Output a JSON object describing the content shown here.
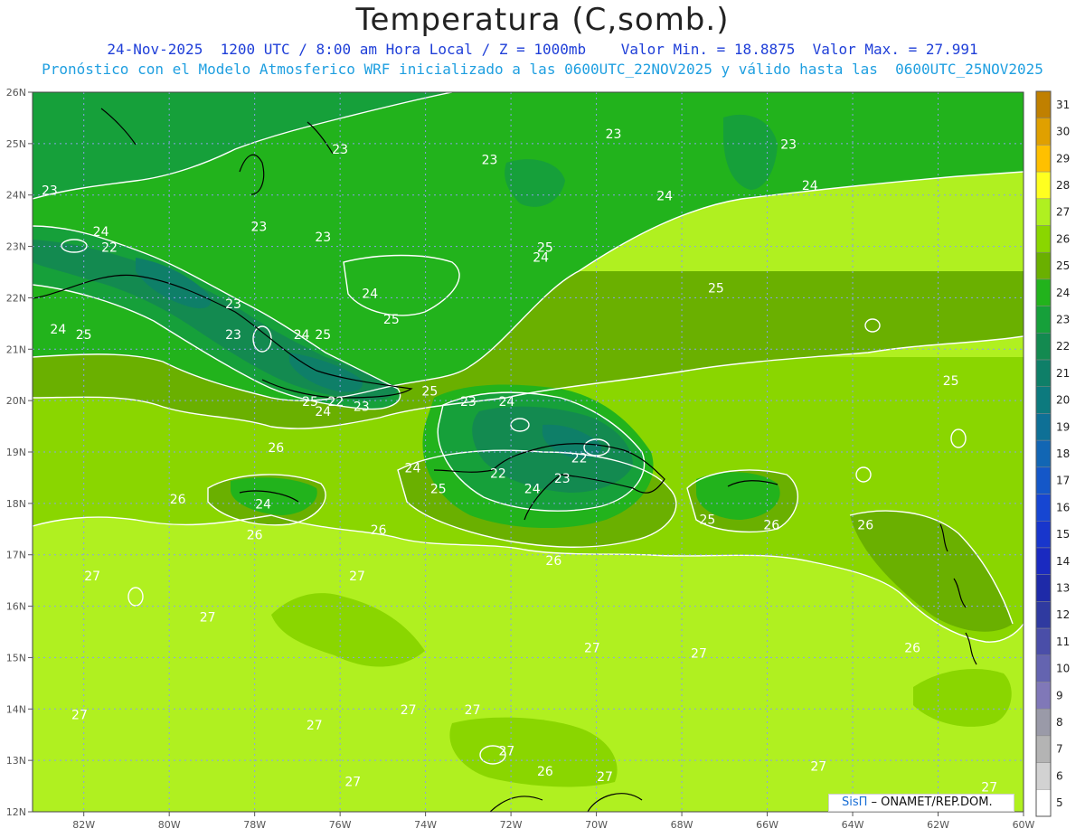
{
  "header": {
    "title": "Temperatura (C,somb.)",
    "line1": "24-Nov-2025  1200 UTC / 8:00 am Hora Local / Z = 1000mb    Valor Min. = 18.8875  Valor Max. = 27.991",
    "line2": "Pronóstico con el Modelo Atmosferico WRF inicializado a las 0600UTC_22NOV2025 y válido hasta las  0600UTC_25NOV2025"
  },
  "map": {
    "lat_ticks": [
      "26N",
      "25N",
      "24N",
      "23N",
      "22N",
      "21N",
      "20N",
      "19N",
      "18N",
      "17N",
      "16N",
      "15N",
      "14N",
      "13N",
      "12N"
    ],
    "lon_ticks": [
      "82W",
      "80W",
      "78W",
      "76W",
      "74W",
      "72W",
      "70W",
      "68W",
      "66W",
      "64W",
      "62W",
      "60W"
    ],
    "lat_range": [
      12,
      26
    ],
    "lon_range": [
      -83.2,
      -60
    ],
    "bands": [
      {
        "level": 27,
        "color": "#b0f020"
      },
      {
        "level": 26,
        "color": "#8ad600"
      },
      {
        "level": 25,
        "color": "#6ab000"
      },
      {
        "level": 24,
        "color": "#22b31c"
      },
      {
        "level": 23,
        "color": "#16a03a"
      },
      {
        "level": 22,
        "color": "#138a50"
      },
      {
        "level": 21,
        "color": "#0e7f68"
      }
    ],
    "contour_labels": [
      {
        "text": "23",
        "lon": -82.8,
        "lat": 24.0
      },
      {
        "text": "24",
        "lon": -81.6,
        "lat": 23.2
      },
      {
        "text": "22",
        "lon": -81.4,
        "lat": 22.9
      },
      {
        "text": "23",
        "lon": -76.0,
        "lat": 24.8
      },
      {
        "text": "23",
        "lon": -72.5,
        "lat": 24.6
      },
      {
        "text": "23",
        "lon": -69.6,
        "lat": 25.1
      },
      {
        "text": "23",
        "lon": -65.5,
        "lat": 24.9
      },
      {
        "text": "24",
        "lon": -65.0,
        "lat": 24.1
      },
      {
        "text": "23",
        "lon": -77.9,
        "lat": 23.3
      },
      {
        "text": "23",
        "lon": -76.4,
        "lat": 23.1
      },
      {
        "text": "24",
        "lon": -68.4,
        "lat": 23.9
      },
      {
        "text": "25",
        "lon": -71.2,
        "lat": 22.9
      },
      {
        "text": "24",
        "lon": -71.3,
        "lat": 22.7
      },
      {
        "text": "25",
        "lon": -67.2,
        "lat": 22.1
      },
      {
        "text": "24",
        "lon": -75.3,
        "lat": 22.0
      },
      {
        "text": "23",
        "lon": -78.5,
        "lat": 21.8
      },
      {
        "text": "24",
        "lon": -82.6,
        "lat": 21.3
      },
      {
        "text": "25",
        "lon": -82.0,
        "lat": 21.2
      },
      {
        "text": "23",
        "lon": -78.5,
        "lat": 21.2
      },
      {
        "text": "24",
        "lon": -76.9,
        "lat": 21.2
      },
      {
        "text": "25",
        "lon": -76.4,
        "lat": 21.2
      },
      {
        "text": "25",
        "lon": -74.8,
        "lat": 21.5
      },
      {
        "text": "25",
        "lon": -61.7,
        "lat": 20.3
      },
      {
        "text": "25",
        "lon": -73.9,
        "lat": 20.1
      },
      {
        "text": "23",
        "lon": -73.0,
        "lat": 19.9
      },
      {
        "text": "24",
        "lon": -72.1,
        "lat": 19.9
      },
      {
        "text": "25",
        "lon": -76.7,
        "lat": 19.9
      },
      {
        "text": "22",
        "lon": -76.1,
        "lat": 19.9
      },
      {
        "text": "24",
        "lon": -76.4,
        "lat": 19.7
      },
      {
        "text": "23",
        "lon": -75.5,
        "lat": 19.8
      },
      {
        "text": "26",
        "lon": -77.5,
        "lat": 19.0
      },
      {
        "text": "22",
        "lon": -70.4,
        "lat": 18.8
      },
      {
        "text": "24",
        "lon": -74.3,
        "lat": 18.6
      },
      {
        "text": "22",
        "lon": -72.3,
        "lat": 18.5
      },
      {
        "text": "23",
        "lon": -70.8,
        "lat": 18.4
      },
      {
        "text": "25",
        "lon": -73.7,
        "lat": 18.2
      },
      {
        "text": "24",
        "lon": -71.5,
        "lat": 18.2
      },
      {
        "text": "26",
        "lon": -79.8,
        "lat": 18.0
      },
      {
        "text": "24",
        "lon": -77.8,
        "lat": 17.9
      },
      {
        "text": "25",
        "lon": -67.4,
        "lat": 17.6
      },
      {
        "text": "26",
        "lon": -65.9,
        "lat": 17.5
      },
      {
        "text": "26",
        "lon": -63.7,
        "lat": 17.5
      },
      {
        "text": "26",
        "lon": -78.0,
        "lat": 17.3
      },
      {
        "text": "26",
        "lon": -75.1,
        "lat": 17.4
      },
      {
        "text": "26",
        "lon": -71.0,
        "lat": 16.8
      },
      {
        "text": "27",
        "lon": -81.8,
        "lat": 16.5
      },
      {
        "text": "27",
        "lon": -75.6,
        "lat": 16.5
      },
      {
        "text": "27",
        "lon": -79.1,
        "lat": 15.7
      },
      {
        "text": "26",
        "lon": -62.6,
        "lat": 15.1
      },
      {
        "text": "27",
        "lon": -70.1,
        "lat": 15.1
      },
      {
        "text": "27",
        "lon": -67.6,
        "lat": 15.0
      },
      {
        "text": "27",
        "lon": -82.1,
        "lat": 13.8
      },
      {
        "text": "27",
        "lon": -76.6,
        "lat": 13.6
      },
      {
        "text": "27",
        "lon": -74.4,
        "lat": 13.9
      },
      {
        "text": "27",
        "lon": -72.9,
        "lat": 13.9
      },
      {
        "text": "27",
        "lon": -72.1,
        "lat": 13.1
      },
      {
        "text": "26",
        "lon": -71.2,
        "lat": 12.7
      },
      {
        "text": "27",
        "lon": -69.8,
        "lat": 12.6
      },
      {
        "text": "27",
        "lon": -64.8,
        "lat": 12.8
      },
      {
        "text": "27",
        "lon": -75.7,
        "lat": 12.5
      },
      {
        "text": "27",
        "lon": -60.8,
        "lat": 12.4
      }
    ]
  },
  "colorbar": {
    "levels": [
      31,
      30,
      29,
      28,
      27,
      26,
      25,
      24,
      23,
      22,
      21,
      20,
      19,
      18,
      17,
      16,
      15,
      14,
      13,
      12,
      11,
      10,
      9,
      8,
      7,
      6,
      5
    ],
    "colors": [
      "#c08000",
      "#e0a000",
      "#ffc000",
      "#ffff20",
      "#b0f020",
      "#8ad600",
      "#6ab000",
      "#22b31c",
      "#16a03a",
      "#138a50",
      "#0e7f68",
      "#0c7a7e",
      "#0e7096",
      "#1266b4",
      "#1457c8",
      "#1646d2",
      "#1836cc",
      "#1a2ac0",
      "#1e2aa8",
      "#2f3aa0",
      "#4a4ea8",
      "#6464b0",
      "#8078b8",
      "#9a9aa8",
      "#b4b4b4",
      "#d2d2d2",
      "#ffffff"
    ]
  },
  "credit": {
    "brand": "SisΠ",
    "text": " – ONAMET/REP.DOM."
  }
}
